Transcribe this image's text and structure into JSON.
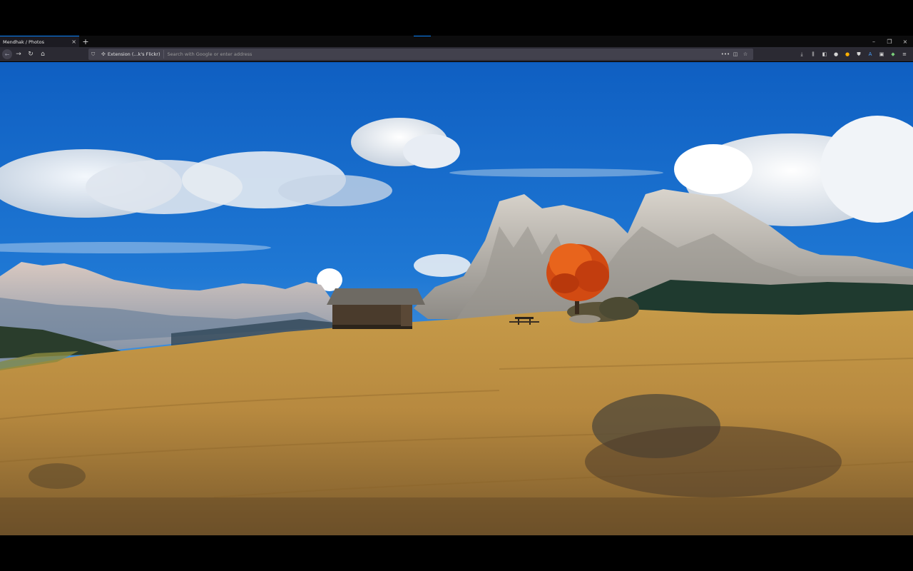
{
  "browser": {
    "tab": {
      "title": "Mendhak / Photos",
      "close_glyph": "×"
    },
    "new_tab_glyph": "+",
    "window": {
      "minimize": "–",
      "restore": "❐",
      "close": "×"
    },
    "nav": {
      "back": "←",
      "forward": "→",
      "reload": "↻",
      "home": "⌂"
    },
    "urlbar": {
      "extension_label": "Extension (...k's Flickr)",
      "placeholder": "Search with Google or enter address",
      "more": "•••",
      "pocket": "◫",
      "bookmark": "☆"
    },
    "toolbar_icons": [
      "download-icon",
      "library-icon",
      "sidebar-icon",
      "account-icon",
      "extension-orange-icon",
      "shield-extension-icon",
      "translate-icon",
      "screenshot-icon",
      "extension-dark-icon",
      "menu-icon"
    ]
  },
  "colors": {
    "accent": "#0a84ff",
    "chrome_bg": "#2b2a33",
    "tab_bg": "#1c1b22",
    "urlbar_bg": "#42414d"
  }
}
